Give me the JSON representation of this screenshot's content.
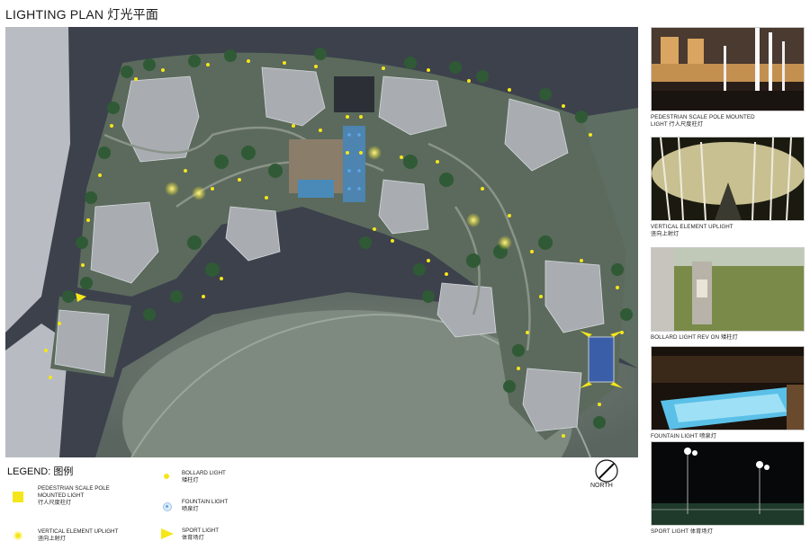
{
  "title": "LIGHTING PLAN 灯光平面",
  "legend": {
    "title": "LEGEND: 图例",
    "items": [
      {
        "en": "PEDESTRIAN SCALE POLE MOUNTED LIGHT",
        "zh": "行人尺度柱灯",
        "symbol": "yellow-square-icon"
      },
      {
        "en": "VERTICAL ELEMENT UPLIGHT",
        "zh": "竖向上射灯",
        "symbol": "yellow-halo-dot-icon"
      },
      {
        "en": "BOLLARD LIGHT",
        "zh": "矮柱灯",
        "symbol": "yellow-dot-icon"
      },
      {
        "en": "FOUNTAIN LIGHT",
        "zh": "喷泉灯",
        "symbol": "blue-dot-icon"
      },
      {
        "en": "SPORT LIGHT",
        "zh": "体育场灯",
        "symbol": "yellow-triangle-icon"
      }
    ],
    "ped_line1": "PEDESTRIAN SCALE POLE",
    "ped_line2": "MOUNTED LIGHT",
    "ped_zh": "行人尺度柱灯"
  },
  "north": {
    "label": "NORTH"
  },
  "photos": [
    {
      "caption_line1": "PEDESTRIAN SCALE POLE MOUNTED",
      "caption_line2": "LIGHT 行人尺度柱灯"
    },
    {
      "caption_line1": "VERTICAL ELEMENT UPLIGHT",
      "caption_line2": "竖向上射灯"
    },
    {
      "caption_line1": "BOLLARD LIGHT REV  ON 矮柱灯",
      "caption_line2": ""
    },
    {
      "caption_line1": "FOUNTAIN LIGHT 喷泉灯",
      "caption_line2": ""
    },
    {
      "caption_line1": "SPORT LIGHT 体育场灯",
      "caption_line2": ""
    }
  ],
  "colors": {
    "light": "#f5e61a",
    "fountain": "#5fa8e8",
    "plan_bg": "#3f4450",
    "lawn": "#5d6d62"
  }
}
